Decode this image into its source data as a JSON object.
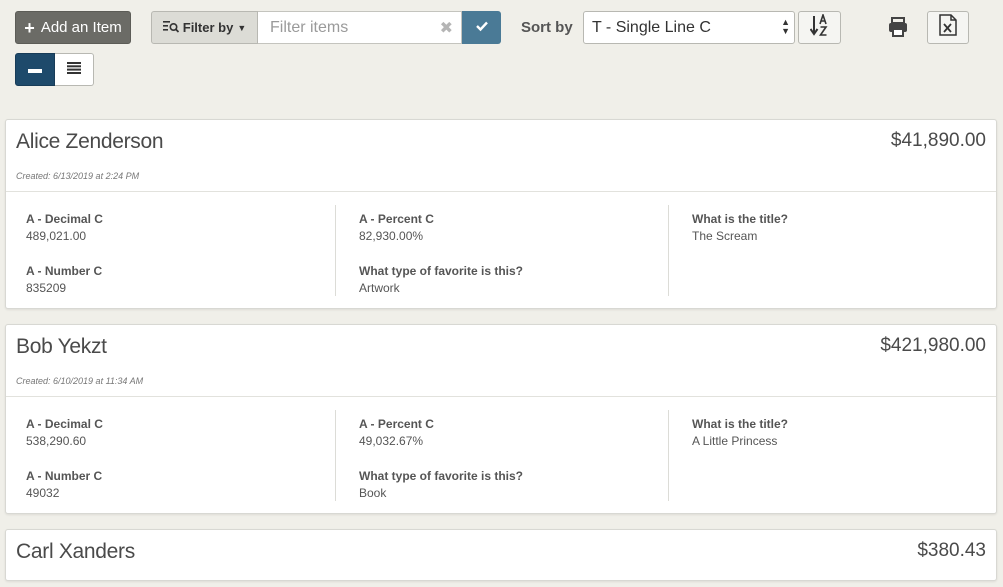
{
  "toolbar": {
    "add_label": "Add an Item",
    "filter_by_label": "Filter by",
    "filter_placeholder": "Filter items",
    "sort_label": "Sort by",
    "sort_value": "T - Single Line C"
  },
  "records": [
    {
      "name": "Alice Zenderson",
      "amount": "$41,890.00",
      "created": "Created: 6/13/2019 at 2:24 PM",
      "fields": {
        "decimal_label": "A - Decimal C",
        "decimal_value": "489,021.00",
        "number_label": "A - Number C",
        "number_value": "835209",
        "percent_label": "A - Percent C",
        "percent_value": "82,930.00%",
        "fav_type_label": "What type of favorite is this?",
        "fav_type_value": "Artwork",
        "title_label": "What is the title?",
        "title_value": "The Scream"
      }
    },
    {
      "name": "Bob Yekzt",
      "amount": "$421,980.00",
      "created": "Created: 6/10/2019 at 11:34 AM",
      "fields": {
        "decimal_label": "A - Decimal C",
        "decimal_value": "538,290.60",
        "number_label": "A - Number C",
        "number_value": "49032",
        "percent_label": "A - Percent C",
        "percent_value": "49,032.67%",
        "fav_type_label": "What type of favorite is this?",
        "fav_type_value": "Book",
        "title_label": "What is the title?",
        "title_value": "A Little Princess"
      }
    },
    {
      "name": "Carl Xanders",
      "amount": "$380.43"
    }
  ],
  "icons": {
    "add": "plus-icon",
    "filter": "filter-list-icon",
    "clear": "close-icon",
    "confirm": "check-icon",
    "sort_direction": "sort-alpha-icon",
    "print": "printer-icon",
    "export": "excel-icon",
    "view_single": "single-line-view-icon",
    "view_list": "list-view-icon"
  },
  "colors": {
    "accent": "#4a7a96",
    "active_toggle": "#1e4a6b",
    "add_button": "#6b6b66",
    "background": "#f0efe9"
  }
}
